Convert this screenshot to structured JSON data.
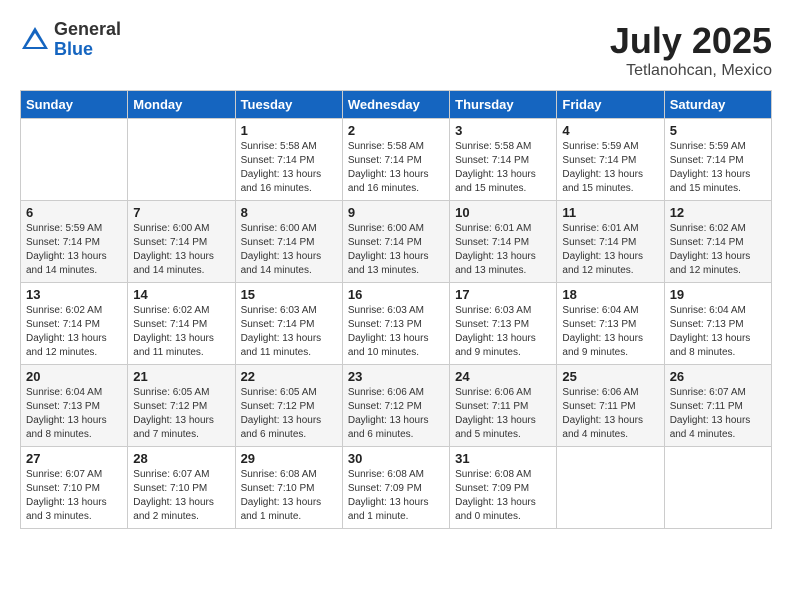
{
  "header": {
    "logo_general": "General",
    "logo_blue": "Blue",
    "month_title": "July 2025",
    "location": "Tetlanohcan, Mexico"
  },
  "days_of_week": [
    "Sunday",
    "Monday",
    "Tuesday",
    "Wednesday",
    "Thursday",
    "Friday",
    "Saturday"
  ],
  "weeks": [
    [
      {
        "day": "",
        "detail": ""
      },
      {
        "day": "",
        "detail": ""
      },
      {
        "day": "1",
        "detail": "Sunrise: 5:58 AM\nSunset: 7:14 PM\nDaylight: 13 hours\nand 16 minutes."
      },
      {
        "day": "2",
        "detail": "Sunrise: 5:58 AM\nSunset: 7:14 PM\nDaylight: 13 hours\nand 16 minutes."
      },
      {
        "day": "3",
        "detail": "Sunrise: 5:58 AM\nSunset: 7:14 PM\nDaylight: 13 hours\nand 15 minutes."
      },
      {
        "day": "4",
        "detail": "Sunrise: 5:59 AM\nSunset: 7:14 PM\nDaylight: 13 hours\nand 15 minutes."
      },
      {
        "day": "5",
        "detail": "Sunrise: 5:59 AM\nSunset: 7:14 PM\nDaylight: 13 hours\nand 15 minutes."
      }
    ],
    [
      {
        "day": "6",
        "detail": "Sunrise: 5:59 AM\nSunset: 7:14 PM\nDaylight: 13 hours\nand 14 minutes."
      },
      {
        "day": "7",
        "detail": "Sunrise: 6:00 AM\nSunset: 7:14 PM\nDaylight: 13 hours\nand 14 minutes."
      },
      {
        "day": "8",
        "detail": "Sunrise: 6:00 AM\nSunset: 7:14 PM\nDaylight: 13 hours\nand 14 minutes."
      },
      {
        "day": "9",
        "detail": "Sunrise: 6:00 AM\nSunset: 7:14 PM\nDaylight: 13 hours\nand 13 minutes."
      },
      {
        "day": "10",
        "detail": "Sunrise: 6:01 AM\nSunset: 7:14 PM\nDaylight: 13 hours\nand 13 minutes."
      },
      {
        "day": "11",
        "detail": "Sunrise: 6:01 AM\nSunset: 7:14 PM\nDaylight: 13 hours\nand 12 minutes."
      },
      {
        "day": "12",
        "detail": "Sunrise: 6:02 AM\nSunset: 7:14 PM\nDaylight: 13 hours\nand 12 minutes."
      }
    ],
    [
      {
        "day": "13",
        "detail": "Sunrise: 6:02 AM\nSunset: 7:14 PM\nDaylight: 13 hours\nand 12 minutes."
      },
      {
        "day": "14",
        "detail": "Sunrise: 6:02 AM\nSunset: 7:14 PM\nDaylight: 13 hours\nand 11 minutes."
      },
      {
        "day": "15",
        "detail": "Sunrise: 6:03 AM\nSunset: 7:14 PM\nDaylight: 13 hours\nand 11 minutes."
      },
      {
        "day": "16",
        "detail": "Sunrise: 6:03 AM\nSunset: 7:13 PM\nDaylight: 13 hours\nand 10 minutes."
      },
      {
        "day": "17",
        "detail": "Sunrise: 6:03 AM\nSunset: 7:13 PM\nDaylight: 13 hours\nand 9 minutes."
      },
      {
        "day": "18",
        "detail": "Sunrise: 6:04 AM\nSunset: 7:13 PM\nDaylight: 13 hours\nand 9 minutes."
      },
      {
        "day": "19",
        "detail": "Sunrise: 6:04 AM\nSunset: 7:13 PM\nDaylight: 13 hours\nand 8 minutes."
      }
    ],
    [
      {
        "day": "20",
        "detail": "Sunrise: 6:04 AM\nSunset: 7:13 PM\nDaylight: 13 hours\nand 8 minutes."
      },
      {
        "day": "21",
        "detail": "Sunrise: 6:05 AM\nSunset: 7:12 PM\nDaylight: 13 hours\nand 7 minutes."
      },
      {
        "day": "22",
        "detail": "Sunrise: 6:05 AM\nSunset: 7:12 PM\nDaylight: 13 hours\nand 6 minutes."
      },
      {
        "day": "23",
        "detail": "Sunrise: 6:06 AM\nSunset: 7:12 PM\nDaylight: 13 hours\nand 6 minutes."
      },
      {
        "day": "24",
        "detail": "Sunrise: 6:06 AM\nSunset: 7:11 PM\nDaylight: 13 hours\nand 5 minutes."
      },
      {
        "day": "25",
        "detail": "Sunrise: 6:06 AM\nSunset: 7:11 PM\nDaylight: 13 hours\nand 4 minutes."
      },
      {
        "day": "26",
        "detail": "Sunrise: 6:07 AM\nSunset: 7:11 PM\nDaylight: 13 hours\nand 4 minutes."
      }
    ],
    [
      {
        "day": "27",
        "detail": "Sunrise: 6:07 AM\nSunset: 7:10 PM\nDaylight: 13 hours\nand 3 minutes."
      },
      {
        "day": "28",
        "detail": "Sunrise: 6:07 AM\nSunset: 7:10 PM\nDaylight: 13 hours\nand 2 minutes."
      },
      {
        "day": "29",
        "detail": "Sunrise: 6:08 AM\nSunset: 7:10 PM\nDaylight: 13 hours\nand 1 minute."
      },
      {
        "day": "30",
        "detail": "Sunrise: 6:08 AM\nSunset: 7:09 PM\nDaylight: 13 hours\nand 1 minute."
      },
      {
        "day": "31",
        "detail": "Sunrise: 6:08 AM\nSunset: 7:09 PM\nDaylight: 13 hours\nand 0 minutes."
      },
      {
        "day": "",
        "detail": ""
      },
      {
        "day": "",
        "detail": ""
      }
    ]
  ]
}
